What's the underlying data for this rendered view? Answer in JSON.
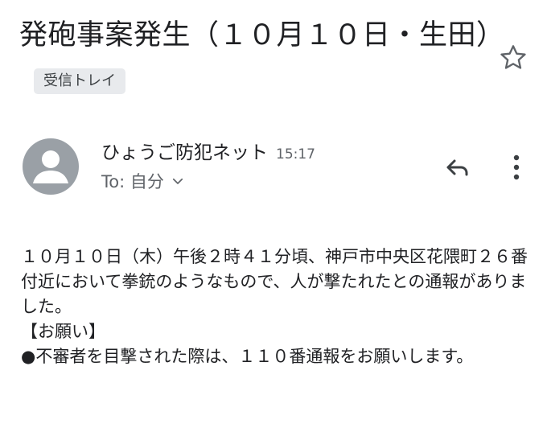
{
  "message": {
    "subject": "発砲事案発生（１０月１０日・生田）",
    "label": "受信トレイ",
    "sender": "ひょうご防犯ネット",
    "time": "15:17",
    "recipient": "To: 自分",
    "body": {
      "paragraph1": "１０月１０日（木）午後２時４１分頃、神戸市中央区花隈町２６番付近において拳銃のようなもので、人が撃たれたとの通報がありました。",
      "heading": "【お願い】",
      "request": "●不審者を目撃された際は、１１０番通報をお願いします。"
    }
  },
  "icons": {
    "star": "star-icon",
    "avatar": "person-avatar-icon",
    "reply": "reply-icon",
    "more": "more-vert-icon",
    "chevron": "chevron-down-icon"
  },
  "colors": {
    "text": "#202124",
    "secondary": "#5f6368",
    "chip_bg": "#e8eaed",
    "avatar_bg": "#9aa0a6"
  }
}
